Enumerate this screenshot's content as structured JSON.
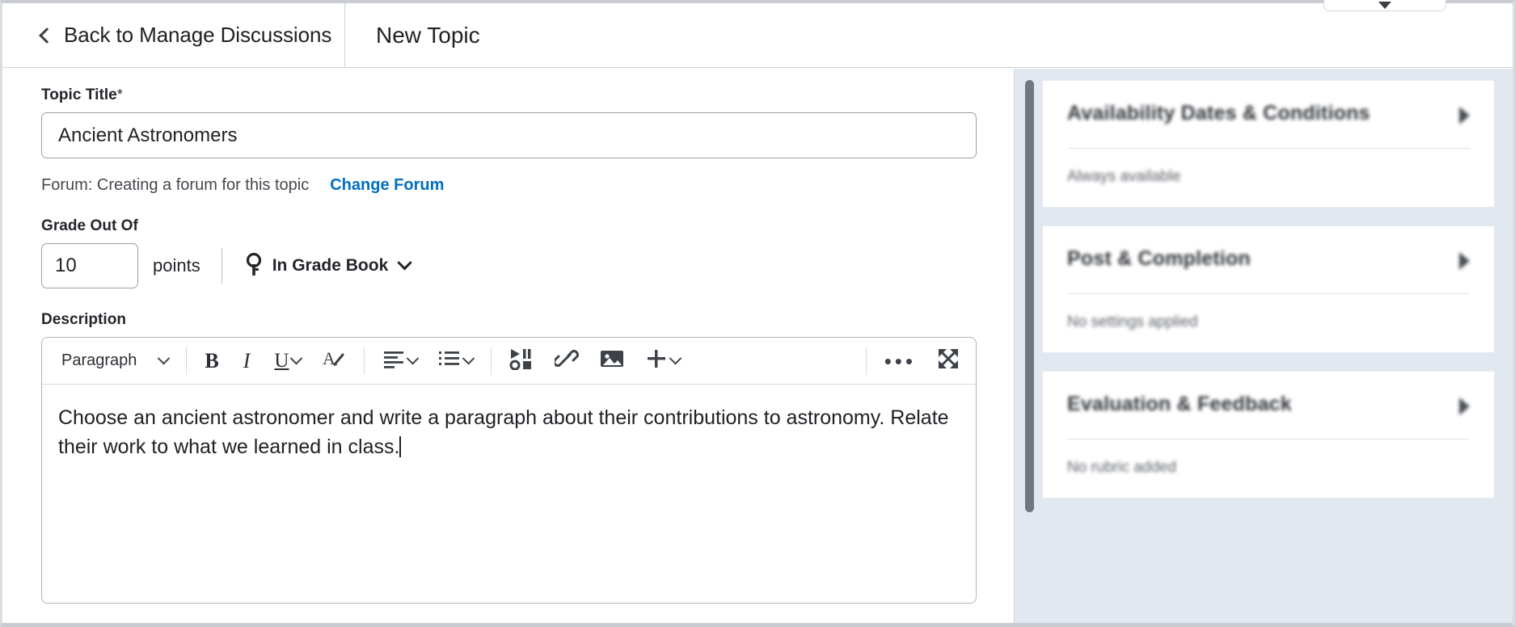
{
  "header": {
    "back_label": "Back to Manage Discussions",
    "back_icon": "chevron-left-icon",
    "page_title": "New Topic"
  },
  "form": {
    "topic_title": {
      "label": "Topic Title",
      "required_marker": "*",
      "value": "Ancient Astronomers",
      "placeholder": ""
    },
    "forum": {
      "text": "Forum: Creating a forum for this topic",
      "change_link": "Change Forum"
    },
    "grade": {
      "label": "Grade Out Of",
      "value": "10",
      "units": "points",
      "gradebook_label": "In Grade Book",
      "gradebook_icon": "key-icon",
      "gradebook_chevron": "chevron-down-icon"
    },
    "description": {
      "label": "Description",
      "body_text": "Choose an ancient astronomer and write a paragraph about their contributions to astronomy. Relate their work to what we learned in class."
    }
  },
  "editor_toolbar": {
    "style_select": "Paragraph",
    "buttons": [
      {
        "name": "bold-icon",
        "glyph": "B"
      },
      {
        "name": "italic-icon",
        "glyph": "I"
      },
      {
        "name": "underline-icon",
        "glyph": "U"
      },
      {
        "name": "text-color-icon",
        "glyph": "A"
      },
      {
        "name": "align-icon",
        "glyph": "align"
      },
      {
        "name": "bullet-list-icon",
        "glyph": "list"
      },
      {
        "name": "insert-media-icon",
        "glyph": "media"
      },
      {
        "name": "insert-link-icon",
        "glyph": "link"
      },
      {
        "name": "insert-image-icon",
        "glyph": "image"
      },
      {
        "name": "insert-more-icon",
        "glyph": "+"
      },
      {
        "name": "overflow-menu-icon",
        "glyph": "•••"
      },
      {
        "name": "fullscreen-icon",
        "glyph": "expand"
      }
    ]
  },
  "sidebar": {
    "panels": [
      {
        "title": "Availability Dates & Conditions",
        "summary": "Always available",
        "toggle_icon": "caret-right-icon"
      },
      {
        "title": "Post & Completion",
        "summary": "No settings applied",
        "toggle_icon": "caret-right-icon"
      },
      {
        "title": "Evaluation & Feedback",
        "summary": "No rubric added",
        "toggle_icon": "caret-right-icon"
      }
    ]
  },
  "colors": {
    "link": "#006fbf",
    "sidebar_bg": "#e2e8f0",
    "text": "#202123"
  }
}
